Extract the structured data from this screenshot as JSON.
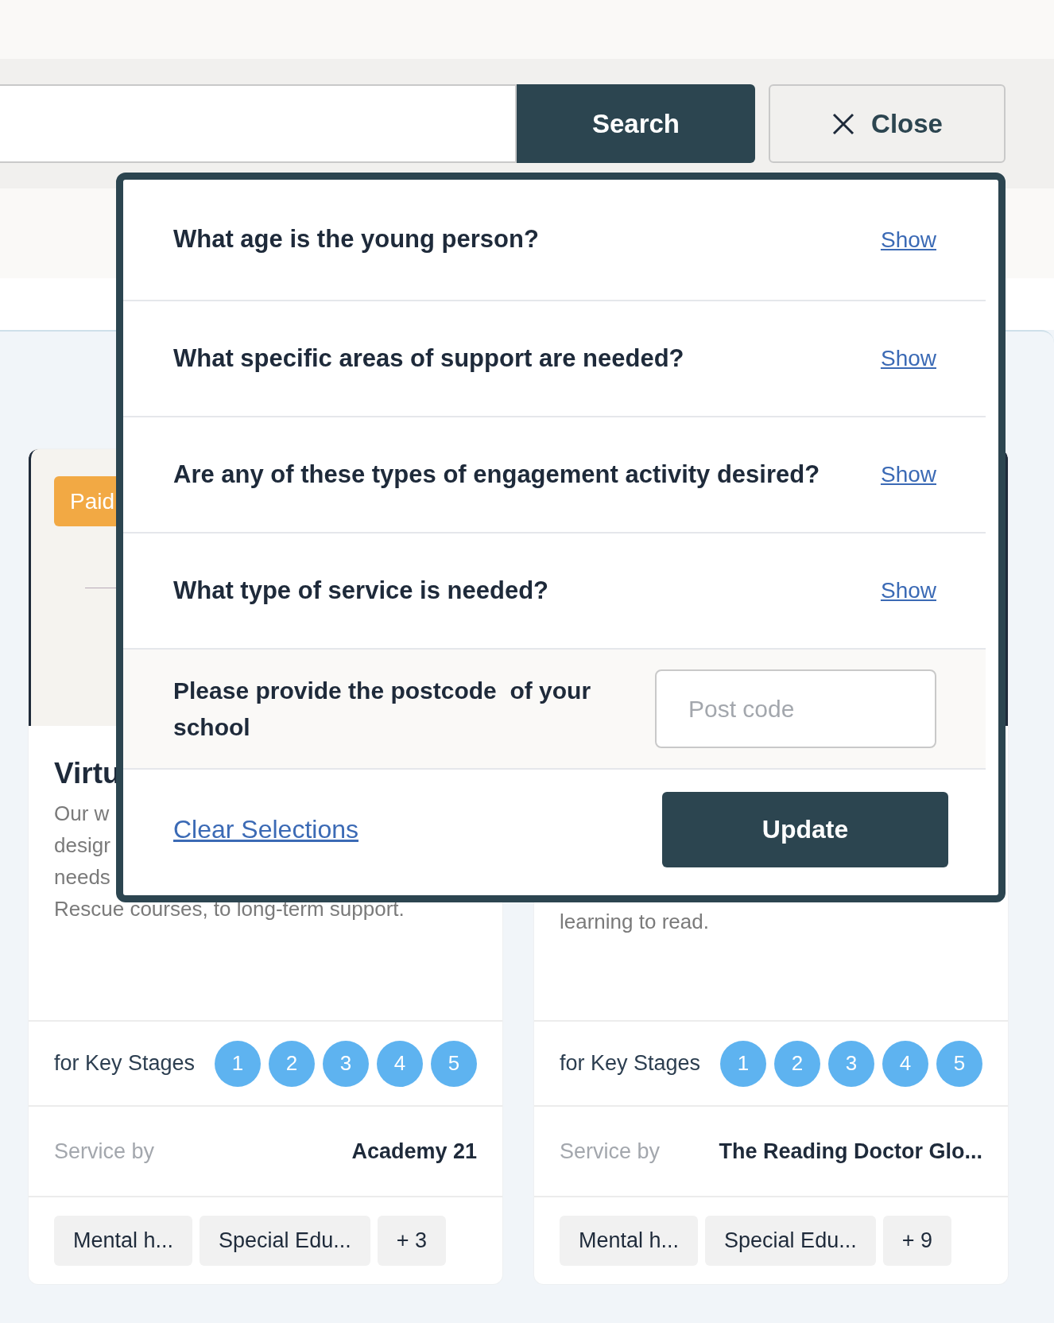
{
  "search": {
    "button": "Search",
    "close": "Close"
  },
  "cards": [
    {
      "badge": "Paid",
      "title": "Virtu",
      "description": [
        "Our w",
        "desigr",
        "needs",
        "Rescue courses, to long-term support."
      ],
      "stages_label": "for Key Stages",
      "stages": [
        "1",
        "2",
        "3",
        "4",
        "5"
      ],
      "service_label": "Service by",
      "provider": "Academy 21",
      "tags": [
        "Mental h...",
        "Special Edu...",
        "+ 3"
      ]
    },
    {
      "description": [
        "learning to read."
      ],
      "stages_label": "for Key Stages",
      "stages": [
        "1",
        "2",
        "3",
        "4",
        "5"
      ],
      "service_label": "Service by",
      "provider": "The Reading Doctor Glo...",
      "tags": [
        "Mental h...",
        "Special Edu...",
        "+ 9"
      ]
    }
  ],
  "filter_panel": {
    "questions": [
      {
        "label": "What age is the young person?",
        "link": "Show"
      },
      {
        "label": "What specific areas of support are needed?",
        "link": "Show"
      },
      {
        "label": "Are any of these types of engagement activity desired?",
        "link": "Show"
      },
      {
        "label": "What type of service is needed?",
        "link": "Show"
      }
    ],
    "postcode": {
      "label": "Please provide the postcode  of your school",
      "placeholder": "Post code"
    },
    "clear": "Clear Selections",
    "update": "Update"
  }
}
